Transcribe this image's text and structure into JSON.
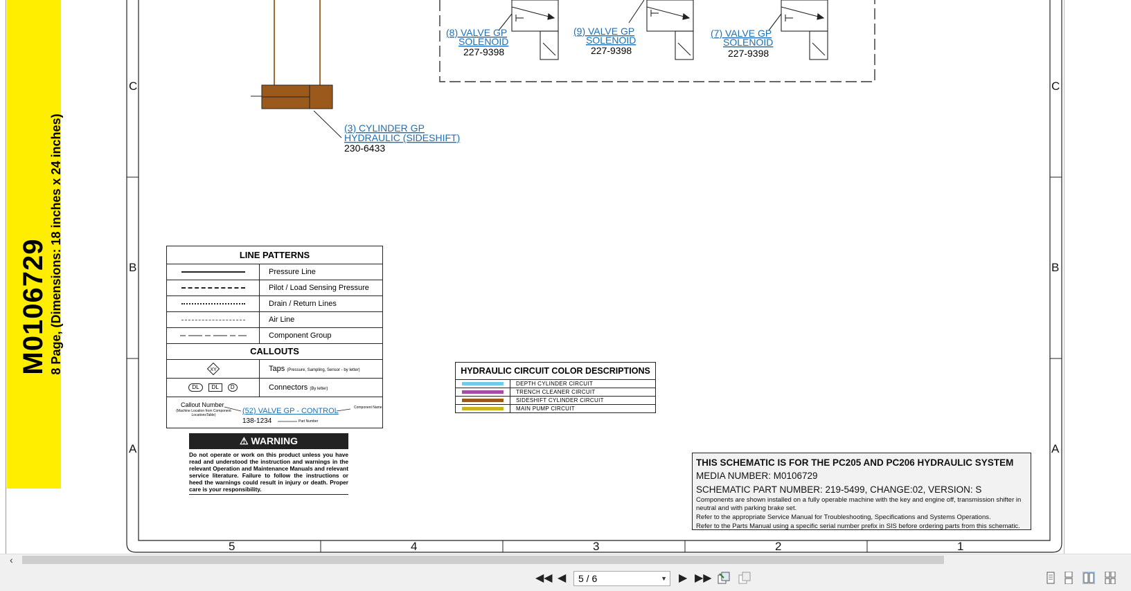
{
  "banner": {
    "media_number": "M0106729",
    "subtitle": "8 Page, (Dimensions: 18 inches x 24 inches)"
  },
  "zones": {
    "rows": [
      "C",
      "B",
      "A"
    ],
    "columns": [
      "5",
      "4",
      "3",
      "2",
      "1"
    ]
  },
  "components": {
    "valve8": {
      "line1": "(8) VALVE GP",
      "line2": "SOLENOID",
      "part": "227-9398"
    },
    "valve9": {
      "line1": "(9) VALVE GP",
      "line2": "SOLENOID",
      "part": "227-9398"
    },
    "valve7": {
      "line1": "(7) VALVE GP",
      "line2": "SOLENOID",
      "part": "227-9398"
    },
    "cylinder3": {
      "line1": "(3) CYLINDER GP",
      "line2": "HYDRAULIC (SIDESHIFT)",
      "part": "230-6433"
    }
  },
  "line_patterns": {
    "title": "LINE PATTERNS",
    "items": [
      "Pressure Line",
      "Pilot / Load Sensing Pressure",
      "Drain / Return Lines",
      "Air Line",
      "Component Group"
    ]
  },
  "callouts": {
    "title": "CALLOUTS",
    "taps_label": "Taps",
    "taps_note": "(Pressure, Sampling, Sensor - by letter)",
    "taps_symbol": "XY",
    "connectors_label": "Connectors",
    "connectors_note": "(By letter)",
    "connector_symbols": [
      "DL",
      "DL",
      "D"
    ],
    "example": {
      "callout_number": "Callout Number",
      "callout_note": "(Machine Location from Component LocationsTable)",
      "link": "(52) VALVE GP - CONTROL",
      "part_number": "138-1234",
      "part_label": "Part Number",
      "component_label": "Component Name"
    }
  },
  "warning": {
    "title": "WARNING",
    "body": "Do not operate or work on this product unless you have read and understood the instruction and warnings in the relevant Operation and Maintenance Manuals and relevant service literature. Failure to follow the instructions or heed the warnings could result in injury or death. Proper care is your responsibility."
  },
  "color_descriptions": {
    "title": "HYDRAULIC CIRCUIT COLOR DESCRIPTIONS",
    "items": [
      {
        "label": "DEPTH CYLINDER CIRCUIT",
        "color": "#6ecbea"
      },
      {
        "label": "TRENCH CLEANER CIRCUIT",
        "color": "#a64ca6"
      },
      {
        "label": "SIDESHIFT CYLINDER CIRCUIT",
        "color": "#9b5a1c"
      },
      {
        "label": "MAIN PUMP CIRCUIT",
        "color": "#c8b41c"
      }
    ]
  },
  "title_block": {
    "heading": "THIS SCHEMATIC IS FOR THE PC205 AND PC206 HYDRAULIC SYSTEM",
    "media": "MEDIA NUMBER: M0106729",
    "schematic": "SCHEMATIC PART NUMBER: 219-5499, CHANGE:02, VERSION: S",
    "note1": "Components are shown installed on a fully operable machine with the key and engine off, transmission shifter in neutral and with parking brake set.",
    "note2": "Refer to the appropriate Service Manual for Troubleshooting, Specifications and Systems Operations.",
    "note3": "Refer to the Parts Manual using a specific serial number prefix in SIS before ordering parts from this schematic."
  },
  "viewer": {
    "page_indicator": "5 / 6",
    "icons": [
      "first-page-icon",
      "prev-page-icon",
      "next-page-icon",
      "last-page-icon",
      "page-extract-icon",
      "page-insert-icon",
      "single-page-icon",
      "continuous-page-icon",
      "two-page-icon",
      "two-page-continuous-icon"
    ]
  },
  "colors": {
    "sideshift": "#9b5a1c",
    "link": "#1c6fb6",
    "banner": "#ffee00"
  }
}
